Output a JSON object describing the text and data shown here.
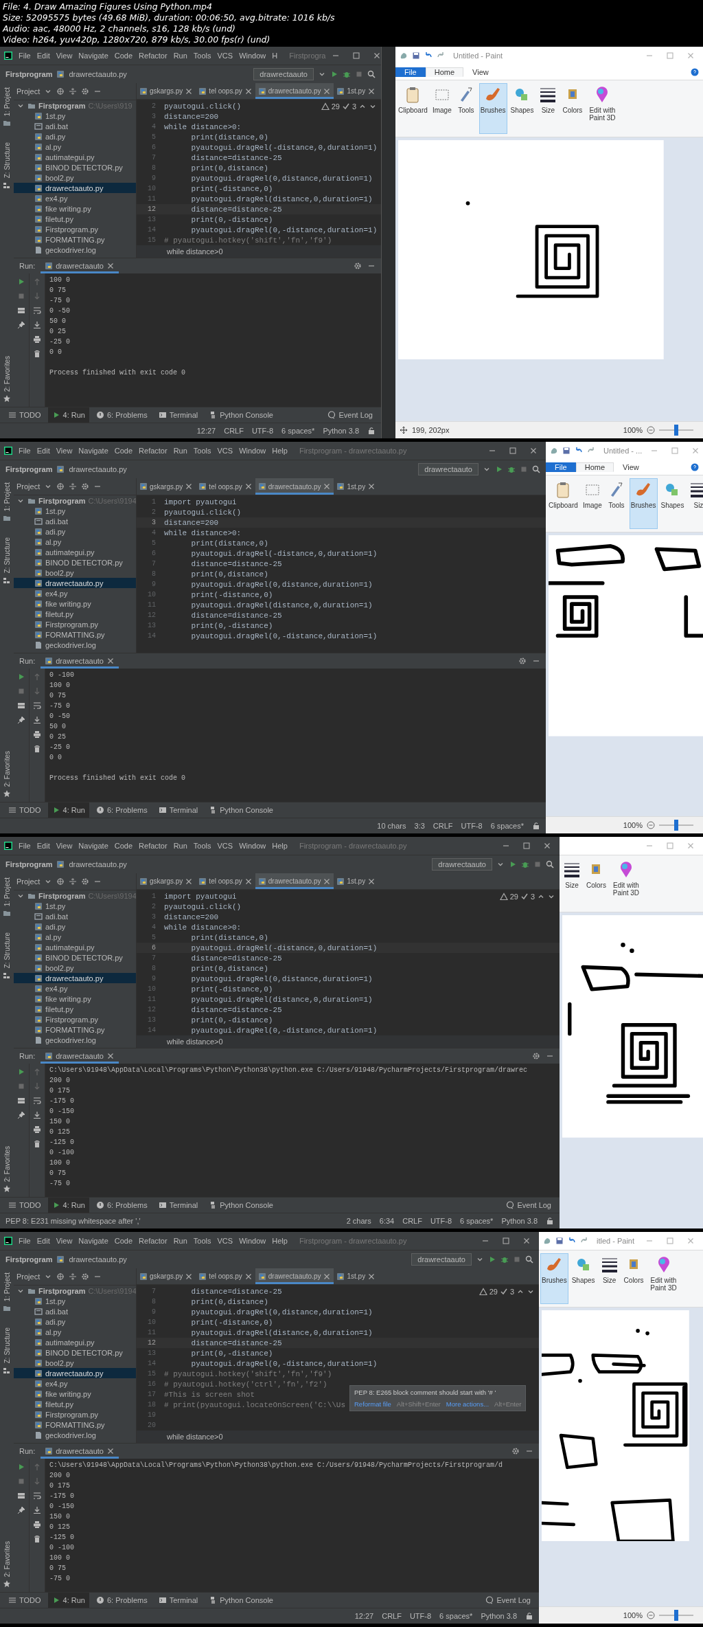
{
  "header": [
    "File: 4. Draw Amazing Figures Using Python.mp4",
    "Size: 52095575 bytes (49.68 MiB), duration: 00:06:50, avg.bitrate: 1016 kb/s",
    "Audio: aac, 48000 Hz, 2 channels, s16, 128 kb/s (und)",
    "Video: h264, yuv420p, 1280x720, 879 kb/s, 30.00 fps(r) (und)"
  ],
  "frames": [
    {
      "ide": {
        "menu": [
          "File",
          "Edit",
          "View",
          "Navigate",
          "Code",
          "Refactor",
          "Run",
          "Tools",
          "VCS",
          "Window",
          "H"
        ],
        "title": "Firstprogra",
        "breadcrumb": [
          "Firstprogram",
          "drawrectaauto.py"
        ],
        "run_config": "drawrectaauto",
        "side_labels": [
          "1: Project",
          "Z: Structure",
          "2: Favorites"
        ],
        "project_label": "Project",
        "tree": {
          "name": "Firstprogram",
          "path": "C:\\Users\\919",
          "expanded": true,
          "children": [
            {
              "name": "1st.py",
              "kind": "py",
              "selected": false
            },
            {
              "name": "adi.bat",
              "kind": "bat",
              "selected": false
            },
            {
              "name": "adi.py",
              "kind": "py",
              "selected": false
            },
            {
              "name": "al.py",
              "kind": "py",
              "selected": false
            },
            {
              "name": "autimategui.py",
              "kind": "py",
              "selected": false
            },
            {
              "name": "BINOD DETECTOR.py",
              "kind": "py",
              "selected": false
            },
            {
              "name": "bool2.py",
              "kind": "py",
              "selected": false
            },
            {
              "name": "drawrectaauto.py",
              "kind": "py",
              "selected": true
            },
            {
              "name": "ex4.py",
              "kind": "py",
              "selected": false
            },
            {
              "name": "fike writing.py",
              "kind": "py",
              "selected": false
            },
            {
              "name": "filetut.py",
              "kind": "py",
              "selected": false
            },
            {
              "name": "Firstprogram.py",
              "kind": "py",
              "selected": false
            },
            {
              "name": "FORMATTING.py",
              "kind": "py",
              "selected": false
            },
            {
              "name": "geckodriver.log",
              "kind": "log",
              "selected": false
            }
          ]
        },
        "tabs": [
          {
            "label": "gskargs.py",
            "selected": false
          },
          {
            "label": "tel oops.py",
            "selected": false
          },
          {
            "label": "drawrectaauto.py",
            "selected": true
          },
          {
            "label": "1st.py",
            "selected": false
          }
        ],
        "inspections": {
          "warnings": "29",
          "weak_warnings": "3"
        },
        "code": [
          {
            "number": "2",
            "text": "pyautogui.click()",
            "kind": "code",
            "current": false
          },
          {
            "number": "3",
            "text": "distance=200",
            "kind": "code",
            "current": false
          },
          {
            "number": "4",
            "text": "while distance>0:",
            "kind": "code",
            "current": false
          },
          {
            "number": "5",
            "text": "      print(distance,0)",
            "kind": "code",
            "current": false
          },
          {
            "number": "6",
            "text": "      pyautogui.dragRel(-distance,0,duration=1)",
            "kind": "code",
            "current": false
          },
          {
            "number": "7",
            "text": "      distance=distance-25",
            "kind": "code",
            "current": false
          },
          {
            "number": "8",
            "text": "      print(0,distance)",
            "kind": "code",
            "current": false
          },
          {
            "number": "9",
            "text": "      pyautogui.dragRel(0,distance,duration=1)",
            "kind": "code",
            "current": false
          },
          {
            "number": "10",
            "text": "      print(-distance,0)",
            "kind": "code",
            "current": false
          },
          {
            "number": "11",
            "text": "      pyautogui.dragRel(distance,0,duration=1)",
            "kind": "code",
            "current": false
          },
          {
            "number": "12",
            "text": "      distance=distance-25",
            "kind": "code",
            "current": true
          },
          {
            "number": "13",
            "text": "      print(0,-distance)",
            "kind": "code",
            "current": false
          },
          {
            "number": "14",
            "text": "      pyautogui.dragRel(0,-distance,duration=1)",
            "kind": "code",
            "current": false
          },
          {
            "number": "15",
            "text": "# pyautogui.hotkey('shift','fn','f9')",
            "kind": "comment",
            "current": false
          }
        ],
        "context": "while distance>0",
        "run_label": "Run:",
        "run_tab": "drawrectaauto",
        "output": [
          "100 0",
          "0 75",
          "-75 0",
          "0 -50",
          "50 0",
          "0 25",
          "-25 0",
          "0 0"
        ],
        "exit_message": "Process finished with exit code 0",
        "tool_tabs": [
          {
            "label": "TODO",
            "kind": "todo",
            "selected": false
          },
          {
            "label": "4: Run",
            "kind": "run",
            "selected": true
          },
          {
            "label": "6: Problems",
            "kind": "problems",
            "selected": false
          },
          {
            "label": "Terminal",
            "kind": "terminal",
            "selected": false
          },
          {
            "label": "Python Console",
            "kind": "console",
            "selected": false
          }
        ],
        "event_log": "Event Log",
        "status": {
          "items": [
            "12:27",
            "CRLF",
            "UTF-8",
            "6 spaces*",
            "Python 3.8"
          ]
        }
      },
      "paint": {
        "title": "Untitled - Paint",
        "tabs": [
          {
            "label": "File",
            "kind": "menu",
            "selected": false
          },
          {
            "label": "Home",
            "kind": "tab",
            "selected": true
          },
          {
            "label": "View",
            "kind": "tab",
            "selected": false
          }
        ],
        "groups": [
          {
            "label": "Clipboard",
            "kind": "clipboard",
            "selected": false
          },
          {
            "label": "Image",
            "kind": "image",
            "selected": false
          },
          {
            "label": "Tools",
            "kind": "tools",
            "selected": false
          },
          {
            "label": "Brushes",
            "kind": "brushes",
            "selected": true
          },
          {
            "label": "Shapes",
            "kind": "shapes",
            "selected": false
          },
          {
            "label": "Size",
            "kind": "size",
            "selected": false
          },
          {
            "label": "Colors",
            "kind": "colors",
            "selected": false
          },
          {
            "label": "Edit with Paint 3D",
            "kind": "paint3d",
            "selected": false
          }
        ],
        "position": "199, 202px",
        "zoom": "100%",
        "zoom_slider": {
          "level": 0.5
        }
      }
    },
    {
      "ide": {
        "menu": [
          "File",
          "Edit",
          "View",
          "Navigate",
          "Code",
          "Refactor",
          "Run",
          "Tools",
          "VCS",
          "Window",
          "Help"
        ],
        "title": "Firstprogram - drawrectaauto.py",
        "breadcrumb": [
          "Firstprogram",
          "drawrectaauto.py"
        ],
        "run_config": "drawrectaauto",
        "side_labels": [
          "1: Project",
          "Z: Structure",
          "2: Favorites"
        ],
        "project_label": "Project",
        "tree": {
          "name": "Firstprogram",
          "path": "C:\\Users\\9194",
          "expanded": true,
          "children": [
            {
              "name": "1st.py",
              "kind": "py",
              "selected": false
            },
            {
              "name": "adi.bat",
              "kind": "bat",
              "selected": false
            },
            {
              "name": "adi.py",
              "kind": "py",
              "selected": false
            },
            {
              "name": "al.py",
              "kind": "py",
              "selected": false
            },
            {
              "name": "autimategui.py",
              "kind": "py",
              "selected": false
            },
            {
              "name": "BINOD DETECTOR.py",
              "kind": "py",
              "selected": false
            },
            {
              "name": "bool2.py",
              "kind": "py",
              "selected": false
            },
            {
              "name": "drawrectaauto.py",
              "kind": "py",
              "selected": true
            },
            {
              "name": "ex4.py",
              "kind": "py",
              "selected": false
            },
            {
              "name": "fike writing.py",
              "kind": "py",
              "selected": false
            },
            {
              "name": "filetut.py",
              "kind": "py",
              "selected": false
            },
            {
              "name": "Firstprogram.py",
              "kind": "py",
              "selected": false
            },
            {
              "name": "FORMATTING.py",
              "kind": "py",
              "selected": false
            },
            {
              "name": "geckodriver.log",
              "kind": "log",
              "selected": false
            }
          ]
        },
        "tabs": [
          {
            "label": "gskargs.py",
            "selected": false
          },
          {
            "label": "tel oops.py",
            "selected": false
          },
          {
            "label": "drawrectaauto.py",
            "selected": true
          },
          {
            "label": "1st.py",
            "selected": false
          }
        ],
        "code": [
          {
            "number": "1",
            "text": "import pyautogui",
            "kind": "code",
            "current": false
          },
          {
            "number": "2",
            "text": "pyautogui.click()",
            "kind": "code",
            "current": false
          },
          {
            "number": "3",
            "text": "distance=200",
            "kind": "code",
            "current": true
          },
          {
            "number": "4",
            "text": "while distance>0:",
            "kind": "code",
            "current": false
          },
          {
            "number": "5",
            "text": "      print(distance,0)",
            "kind": "code",
            "current": false
          },
          {
            "number": "6",
            "text": "      pyautogui.dragRel(-distance,0,duration=1)",
            "kind": "code",
            "current": false
          },
          {
            "number": "7",
            "text": "      distance=distance-25",
            "kind": "code",
            "current": false
          },
          {
            "number": "8",
            "text": "      print(0,distance)",
            "kind": "code",
            "current": false
          },
          {
            "number": "9",
            "text": "      pyautogui.dragRel(0,distance,duration=1)",
            "kind": "code",
            "current": false
          },
          {
            "number": "10",
            "text": "      print(-distance,0)",
            "kind": "code",
            "current": false
          },
          {
            "number": "11",
            "text": "      pyautogui.dragRel(distance,0,duration=1)",
            "kind": "code",
            "current": false
          },
          {
            "number": "12",
            "text": "      distance=distance-25",
            "kind": "code",
            "current": false
          },
          {
            "number": "13",
            "text": "      print(0,-distance)",
            "kind": "code",
            "current": false
          },
          {
            "number": "14",
            "text": "      pyautogui.dragRel(0,-distance,duration=1)",
            "kind": "code",
            "current": false
          }
        ],
        "run_label": "Run:",
        "run_tab": "drawrectaauto",
        "output": [
          "0 -100",
          "100 0",
          "0 75",
          "-75 0",
          "0 -50",
          "50 0",
          "0 25",
          "-25 0",
          "0 0"
        ],
        "exit_message": "Process finished with exit code 0",
        "tool_tabs": [
          {
            "label": "TODO",
            "kind": "todo",
            "selected": false
          },
          {
            "label": "4: Run",
            "kind": "run",
            "selected": true
          },
          {
            "label": "6: Problems",
            "kind": "problems",
            "selected": false
          },
          {
            "label": "Terminal",
            "kind": "terminal",
            "selected": false
          },
          {
            "label": "Python Console",
            "kind": "console",
            "selected": false
          }
        ],
        "status": {
          "items": [
            "10 chars",
            "3:3",
            "CRLF",
            "UTF-8",
            "6 spaces*"
          ]
        }
      },
      "paint": {
        "title": "Untitled - ...",
        "tabs": [
          {
            "label": "File",
            "kind": "menu",
            "selected": false
          },
          {
            "label": "Home",
            "kind": "tab",
            "selected": true
          },
          {
            "label": "View",
            "kind": "tab",
            "selected": false
          }
        ],
        "groups": [
          {
            "label": "Clipboard",
            "kind": "clipboard",
            "selected": false
          },
          {
            "label": "Image",
            "kind": "image",
            "selected": false
          },
          {
            "label": "Tools",
            "kind": "tools",
            "selected": false
          },
          {
            "label": "Brushes",
            "kind": "brushes",
            "selected": true
          },
          {
            "label": "Shapes",
            "kind": "shapes",
            "selected": false
          },
          {
            "label": "Siz",
            "kind": "size",
            "selected": false
          }
        ],
        "zoom": "100%",
        "zoom_slider": {
          "level": 0.5
        }
      }
    },
    {
      "ide": {
        "menu": [
          "File",
          "Edit",
          "View",
          "Navigate",
          "Code",
          "Refactor",
          "Run",
          "Tools",
          "VCS",
          "Window",
          "Help"
        ],
        "title": "Firstprogram - drawrectaauto.py",
        "breadcrumb": [
          "Firstprogram",
          "drawrectaauto.py"
        ],
        "run_config": "drawrectaauto",
        "side_labels": [
          "1: Project",
          "Z: Structure",
          "2: Favorites"
        ],
        "project_label": "Project",
        "tree": {
          "name": "Firstprogram",
          "path": "C:\\Users\\9194",
          "expanded": true,
          "children": [
            {
              "name": "1st.py",
              "kind": "py",
              "selected": false
            },
            {
              "name": "adi.bat",
              "kind": "bat",
              "selected": false
            },
            {
              "name": "adi.py",
              "kind": "py",
              "selected": false
            },
            {
              "name": "al.py",
              "kind": "py",
              "selected": false
            },
            {
              "name": "autimategui.py",
              "kind": "py",
              "selected": false
            },
            {
              "name": "BINOD DETECTOR.py",
              "kind": "py",
              "selected": false
            },
            {
              "name": "bool2.py",
              "kind": "py",
              "selected": false
            },
            {
              "name": "drawrectaauto.py",
              "kind": "py",
              "selected": true
            },
            {
              "name": "ex4.py",
              "kind": "py",
              "selected": false
            },
            {
              "name": "fike writing.py",
              "kind": "py",
              "selected": false
            },
            {
              "name": "filetut.py",
              "kind": "py",
              "selected": false
            },
            {
              "name": "Firstprogram.py",
              "kind": "py",
              "selected": false
            },
            {
              "name": "FORMATTING.py",
              "kind": "py",
              "selected": false
            },
            {
              "name": "geckodriver.log",
              "kind": "log",
              "selected": false
            }
          ]
        },
        "tabs": [
          {
            "label": "gskargs.py",
            "selected": false
          },
          {
            "label": "tel oops.py",
            "selected": false
          },
          {
            "label": "drawrectaauto.py",
            "selected": true
          },
          {
            "label": "1st.py",
            "selected": false
          }
        ],
        "inspections": {
          "warnings": "29",
          "weak_warnings": "3"
        },
        "code": [
          {
            "number": "1",
            "text": "import pyautogui",
            "kind": "code",
            "current": false
          },
          {
            "number": "2",
            "text": "pyautogui.click()",
            "kind": "code",
            "current": false
          },
          {
            "number": "3",
            "text": "distance=200",
            "kind": "code",
            "current": false
          },
          {
            "number": "4",
            "text": "while distance>0:",
            "kind": "code",
            "current": false
          },
          {
            "number": "5",
            "text": "      print(distance,0)",
            "kind": "code",
            "current": false
          },
          {
            "number": "6",
            "text": "      pyautogui.dragRel(-distance,0,duration=1)",
            "kind": "code",
            "current": true
          },
          {
            "number": "7",
            "text": "      distance=distance-25",
            "kind": "code",
            "current": false
          },
          {
            "number": "8",
            "text": "      print(0,distance)",
            "kind": "code",
            "current": false
          },
          {
            "number": "9",
            "text": "      pyautogui.dragRel(0,distance,duration=1)",
            "kind": "code",
            "current": false
          },
          {
            "number": "10",
            "text": "      print(-distance,0)",
            "kind": "code",
            "current": false
          },
          {
            "number": "11",
            "text": "      pyautogui.dragRel(distance,0,duration=1)",
            "kind": "code",
            "current": false
          },
          {
            "number": "12",
            "text": "      distance=distance-25",
            "kind": "code",
            "current": false
          },
          {
            "number": "13",
            "text": "      print(0,-distance)",
            "kind": "code",
            "current": false
          },
          {
            "number": "14",
            "text": "      pyautogui.dragRel(0,-distance,duration=1)",
            "kind": "code",
            "current": false
          }
        ],
        "context": "while distance>0",
        "run_label": "Run:",
        "run_tab": "drawrectaauto",
        "output": [
          "C:\\Users\\91948\\AppData\\Local\\Programs\\Python\\Python38\\python.exe C:/Users/91948/PycharmProjects/Firstprogram/drawrec",
          "200 0",
          "0 175",
          "-175 0",
          "0 -150",
          "150 0",
          "0 125",
          "-125 0",
          "0 -100",
          "100 0",
          "0 75",
          "-75 0"
        ],
        "tool_tabs": [
          {
            "label": "TODO",
            "kind": "todo",
            "selected": false
          },
          {
            "label": "4: Run",
            "kind": "run",
            "selected": true
          },
          {
            "label": "6: Problems",
            "kind": "problems",
            "selected": false
          },
          {
            "label": "Terminal",
            "kind": "terminal",
            "selected": false
          },
          {
            "label": "Python Console",
            "kind": "console",
            "selected": false
          }
        ],
        "event_log": "Event Log",
        "status": {
          "message": "PEP 8: E231 missing whitespace after ','",
          "items": [
            "2 chars",
            "6:34",
            "CRLF",
            "UTF-8",
            "6 spaces*",
            "Python 3.8"
          ]
        }
      },
      "paint": {
        "groups": [
          {
            "label": "Size",
            "kind": "size",
            "selected": false
          },
          {
            "label": "Colors",
            "kind": "colors",
            "selected": false
          },
          {
            "label": "Edit with Paint 3D",
            "kind": "paint3d",
            "selected": false
          }
        ]
      }
    },
    {
      "ide": {
        "menu": [
          "File",
          "Edit",
          "View",
          "Navigate",
          "Code",
          "Refactor",
          "Run",
          "Tools",
          "VCS",
          "Window",
          "Help"
        ],
        "title": "Firstprogram - drawrectaauto.py",
        "breadcrumb": [
          "Firstprogram",
          "drawrectaauto.py"
        ],
        "run_config": "drawrectaauto",
        "side_labels": [
          "1: Project",
          "Z: Structure",
          "2: Favorites"
        ],
        "project_label": "Project",
        "tree": {
          "name": "Firstprogram",
          "path": "C:\\Users\\9194",
          "expanded": true,
          "children": [
            {
              "name": "1st.py",
              "kind": "py",
              "selected": false
            },
            {
              "name": "adi.bat",
              "kind": "bat",
              "selected": false
            },
            {
              "name": "adi.py",
              "kind": "py",
              "selected": false
            },
            {
              "name": "al.py",
              "kind": "py",
              "selected": false
            },
            {
              "name": "autimategui.py",
              "kind": "py",
              "selected": false
            },
            {
              "name": "BINOD DETECTOR.py",
              "kind": "py",
              "selected": false
            },
            {
              "name": "bool2.py",
              "kind": "py",
              "selected": false
            },
            {
              "name": "drawrectaauto.py",
              "kind": "py",
              "selected": true
            },
            {
              "name": "ex4.py",
              "kind": "py",
              "selected": false
            },
            {
              "name": "fike writing.py",
              "kind": "py",
              "selected": false
            },
            {
              "name": "filetut.py",
              "kind": "py",
              "selected": false
            },
            {
              "name": "Firstprogram.py",
              "kind": "py",
              "selected": false
            },
            {
              "name": "FORMATTING.py",
              "kind": "py",
              "selected": false
            },
            {
              "name": "geckodriver.log",
              "kind": "log",
              "selected": false
            }
          ]
        },
        "tabs": [
          {
            "label": "gskargs.py",
            "selected": false
          },
          {
            "label": "tel oops.py",
            "selected": false
          },
          {
            "label": "drawrectaauto.py",
            "selected": true
          },
          {
            "label": "1st.py",
            "selected": false
          }
        ],
        "inspections": {
          "warnings": "29",
          "weak_warnings": "3"
        },
        "code": [
          {
            "number": "7",
            "text": "      distance=distance-25",
            "kind": "code",
            "current": false
          },
          {
            "number": "8",
            "text": "      print(0,distance)",
            "kind": "code",
            "current": false
          },
          {
            "number": "9",
            "text": "      pyautogui.dragRel(0,distance,duration=1)",
            "kind": "code",
            "current": false
          },
          {
            "number": "10",
            "text": "      print(-distance,0)",
            "kind": "code",
            "current": false
          },
          {
            "number": "11",
            "text": "      pyautogui.dragRel(distance,0,duration=1)",
            "kind": "code",
            "current": false
          },
          {
            "number": "12",
            "text": "      distance=distance-25",
            "kind": "code",
            "current": true
          },
          {
            "number": "13",
            "text": "      print(0,-distance)",
            "kind": "code",
            "current": false
          },
          {
            "number": "14",
            "text": "      pyautogui.dragRel(0,-distance,duration=1)",
            "kind": "code",
            "current": false
          },
          {
            "number": "15",
            "text": "# pyautogui.hotkey('shift','fn','f9')",
            "kind": "comment",
            "current": false
          },
          {
            "number": "16",
            "text": "# pyautogui.hotkey('ctrl','fn','f2')",
            "kind": "comment",
            "current": false
          },
          {
            "number": "17",
            "text": "#This is screen shot",
            "kind": "comment",
            "current": false
          },
          {
            "number": "18",
            "text": "# print(pyautogui.locateOnScreen('C:\\\\Us",
            "kind": "comment",
            "current": false
          },
          {
            "number": "19",
            "current": false
          },
          {
            "number": "20",
            "current": false
          }
        ],
        "popup": {
          "message": "PEP 8: E265 block comment should start with '# '",
          "actions": [
            {
              "label": "Reformat file",
              "shortcut": "Alt+Shift+Enter"
            },
            {
              "label": "More actions...",
              "shortcut": "Alt+Enter"
            }
          ]
        },
        "context": "while distance>0",
        "run_label": "Run:",
        "run_tab": "drawrectaauto",
        "output": [
          "C:\\Users\\91948\\AppData\\Local\\Programs\\Python\\Python38\\python.exe C:/Users/91948/PycharmProjects/Firstprogram/d",
          "200 0",
          "0 175",
          "-175 0",
          "0 -150",
          "150 0",
          "0 125",
          "-125 0",
          "0 -100",
          "100 0",
          "0 75",
          "-75 0"
        ],
        "tool_tabs": [
          {
            "label": "TODO",
            "kind": "todo",
            "selected": false
          },
          {
            "label": "4: Run",
            "kind": "run",
            "selected": true
          },
          {
            "label": "6: Problems",
            "kind": "problems",
            "selected": false
          },
          {
            "label": "Terminal",
            "kind": "terminal",
            "selected": false
          },
          {
            "label": "Python Console",
            "kind": "console",
            "selected": false
          }
        ],
        "event_log": "Event Log",
        "status": {
          "items": [
            "12:27",
            "CRLF",
            "UTF-8",
            "6 spaces*",
            "Python 3.8"
          ]
        }
      },
      "paint": {
        "title": "itled - Paint",
        "groups": [
          {
            "label": "Brushes",
            "kind": "brushes",
            "selected": true
          },
          {
            "label": "Shapes",
            "kind": "shapes",
            "selected": false
          },
          {
            "label": "Size",
            "kind": "size",
            "selected": false
          },
          {
            "label": "Colors",
            "kind": "colors",
            "selected": false
          },
          {
            "label": "Edit with Paint 3D",
            "kind": "paint3d",
            "selected": false
          }
        ],
        "zoom": "100%",
        "zoom_slider": {
          "level": 0.5
        }
      }
    }
  ]
}
